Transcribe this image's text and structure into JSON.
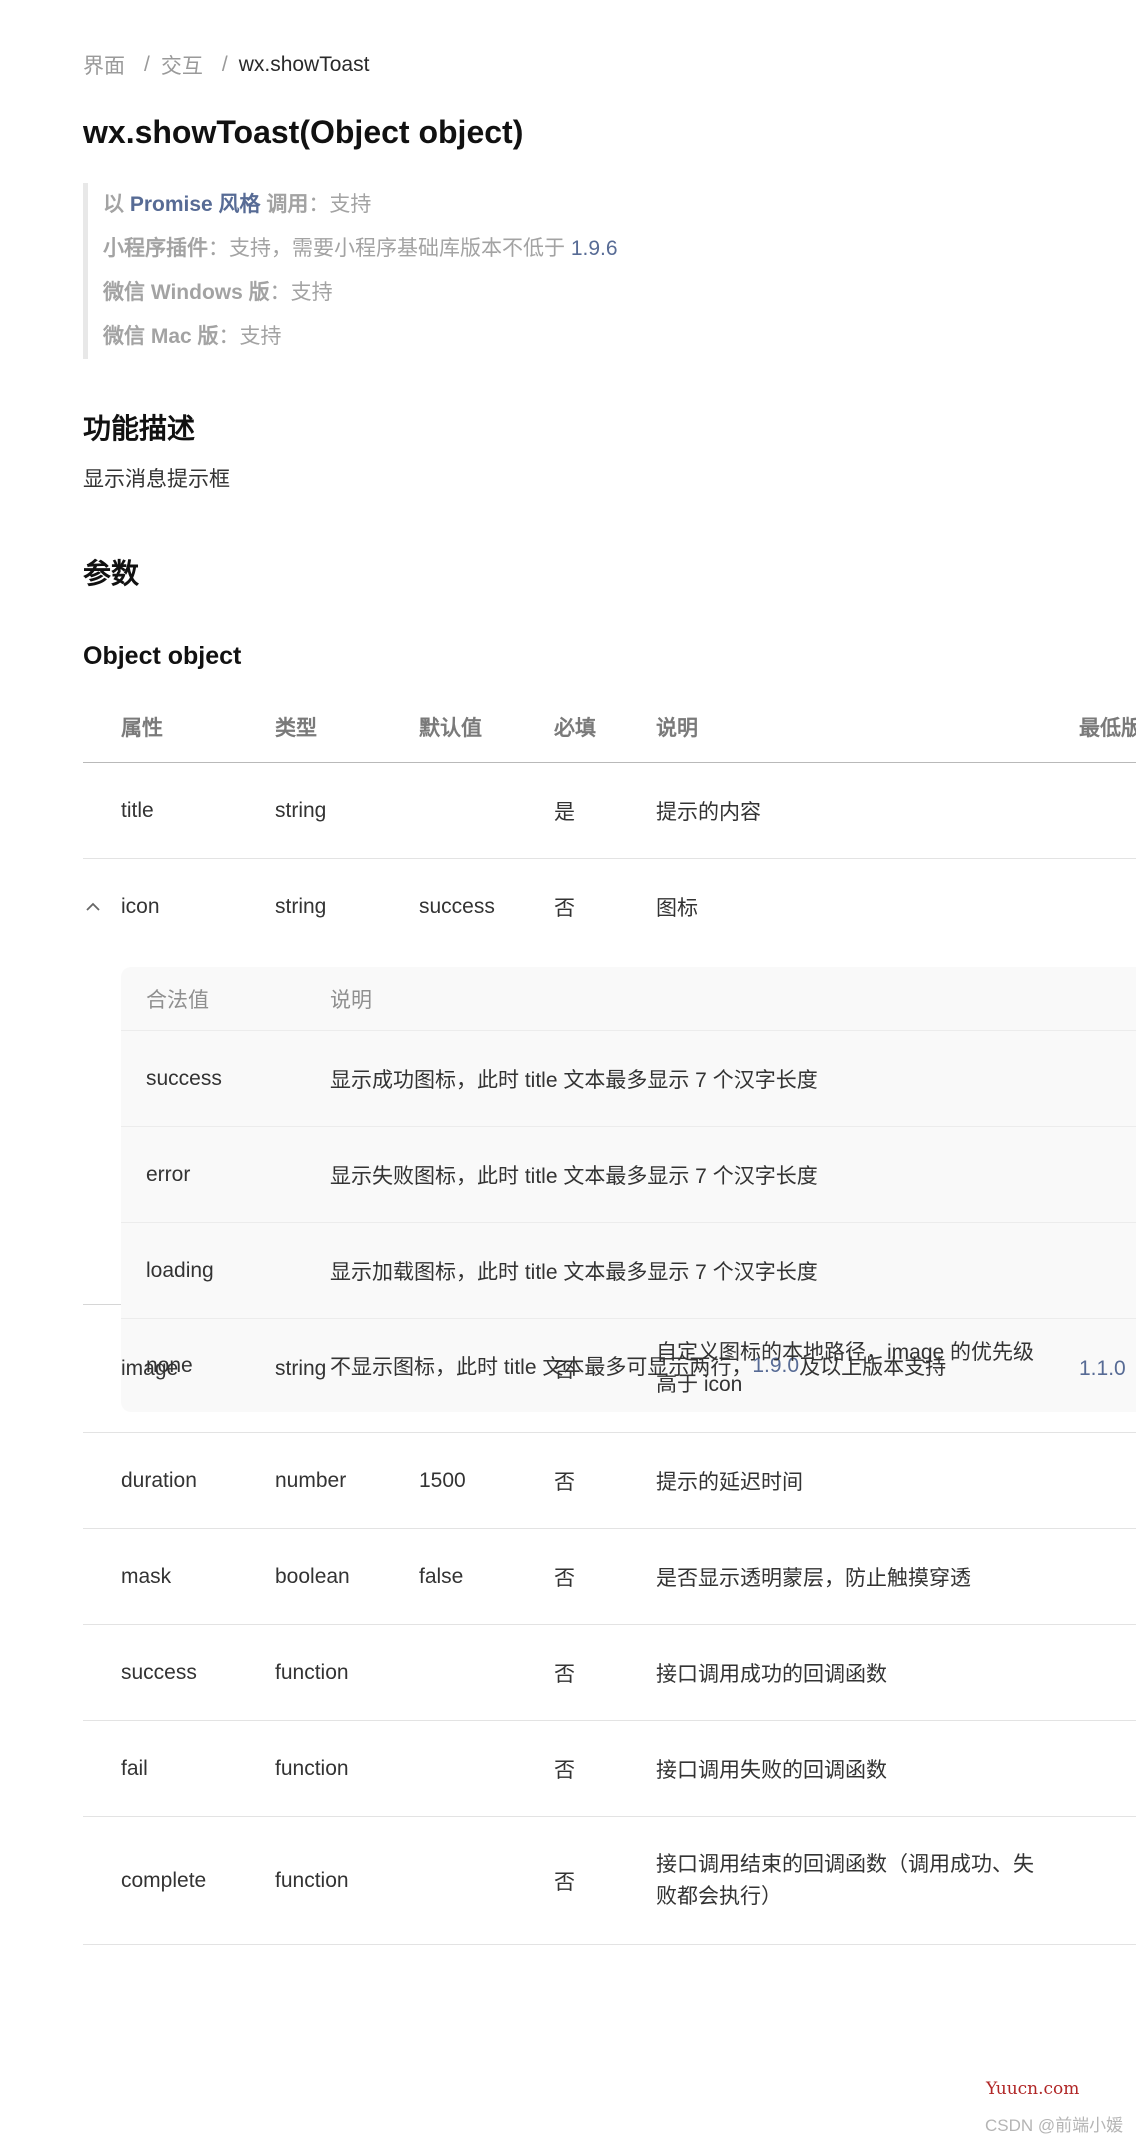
{
  "breadcrumb": {
    "items": [
      "界面",
      "交互"
    ],
    "separator": "/",
    "current": "wx.showToast"
  },
  "title": "wx.showToast(Object object)",
  "support": {
    "promise": {
      "prefix": "以",
      "highlight": "Promise 风格",
      "suffix": "调用",
      "value": "：支持"
    },
    "plugin": {
      "label": "小程序插件",
      "value": "：支持，需要小程序基础库版本不低于",
      "version": "1.9.6"
    },
    "windows": {
      "label": "微信 Windows 版",
      "value": "：支持"
    },
    "mac": {
      "label": "微信 Mac 版",
      "value": "：支持"
    }
  },
  "sections": {
    "feature_heading": "功能描述",
    "feature_desc": "显示消息提示框",
    "params_heading": "参数",
    "object_heading": "Object object"
  },
  "table": {
    "headers": [
      "属性",
      "类型",
      "默认值",
      "必填",
      "说明",
      "最低版"
    ],
    "rows": [
      {
        "prop": "title",
        "type": "string",
        "default": "",
        "required": "是",
        "desc": "提示的内容",
        "min": ""
      },
      {
        "prop": "icon",
        "type": "string",
        "default": "success",
        "required": "否",
        "desc": "图标",
        "min": "",
        "expanded": true
      },
      {
        "prop": "image",
        "type": "string",
        "default": "",
        "required": "否",
        "desc": "自定义图标的本地路径，image 的优先级高于 icon",
        "min": "1.1.0"
      },
      {
        "prop": "duration",
        "type": "number",
        "default": "1500",
        "required": "否",
        "desc": "提示的延迟时间",
        "min": ""
      },
      {
        "prop": "mask",
        "type": "boolean",
        "default": "false",
        "required": "否",
        "desc": "是否显示透明蒙层，防止触摸穿透",
        "min": ""
      },
      {
        "prop": "success",
        "type": "function",
        "default": "",
        "required": "否",
        "desc": "接口调用成功的回调函数",
        "min": ""
      },
      {
        "prop": "fail",
        "type": "function",
        "default": "",
        "required": "否",
        "desc": "接口调用失败的回调函数",
        "min": ""
      },
      {
        "prop": "complete",
        "type": "function",
        "default": "",
        "required": "否",
        "desc": "接口调用结束的回调函数（调用成功、失败都会执行）",
        "min": ""
      }
    ]
  },
  "icon_values": {
    "headers": [
      "合法值",
      "说明"
    ],
    "rows": [
      {
        "value": "success",
        "desc": "显示成功图标，此时 title 文本最多显示 7 个汉字长度"
      },
      {
        "value": "error",
        "desc": "显示失败图标，此时 title 文本最多显示 7 个汉字长度"
      },
      {
        "value": "loading",
        "desc": "显示加载图标，此时 title 文本最多显示 7 个汉字长度"
      },
      {
        "value": "none",
        "desc_before": "不显示图标，此时 title 文本最多可显示两行，",
        "version": "1.9.0",
        "desc_after": "及以上版本支持"
      }
    ]
  },
  "icons": {
    "expand": "chevron-up-icon"
  },
  "colors": {
    "link": "#576b95",
    "watermark_site": "#b02626",
    "watermark_author": "#b5b5b5"
  },
  "watermark": {
    "site": "Yuucn.com",
    "author": "CSDN @前端小媛"
  }
}
